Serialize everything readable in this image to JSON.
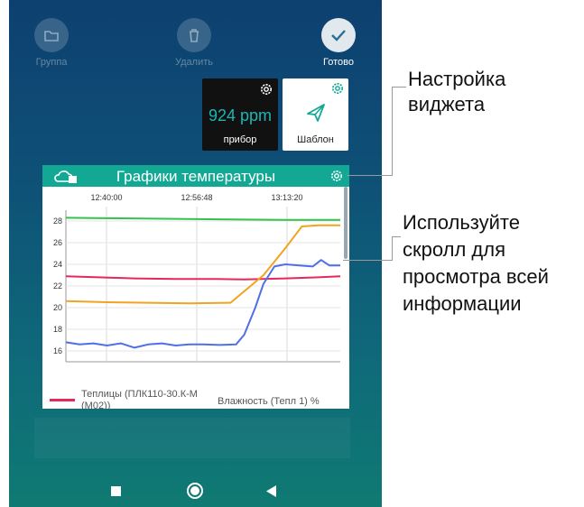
{
  "toolbar": {
    "group_label": "Группа",
    "delete_label": "Удалить",
    "done_label": "Готово"
  },
  "tiles": {
    "device": {
      "value": "924 ppm",
      "label": "прибор"
    },
    "template": {
      "label": "Шаблон"
    }
  },
  "widget": {
    "title": "Графики температуры"
  },
  "chart_data": {
    "type": "line",
    "x_ticks": [
      "12:40:00",
      "12:56:48",
      "13:13:20"
    ],
    "y_ticks": [
      28,
      26,
      24,
      22,
      20,
      18,
      16
    ],
    "ylim": [
      15,
      29
    ],
    "grid": true,
    "series": [
      {
        "color": "#33c24d",
        "points": [
          [
            0,
            28.3
          ],
          [
            0.2,
            28.25
          ],
          [
            0.4,
            28.2
          ],
          [
            0.6,
            28.15
          ],
          [
            0.8,
            28.1
          ],
          [
            1,
            28.1
          ]
        ]
      },
      {
        "color": "#e6285a",
        "points": [
          [
            0,
            22.9
          ],
          [
            0.12,
            22.8
          ],
          [
            0.25,
            22.7
          ],
          [
            0.4,
            22.65
          ],
          [
            0.55,
            22.65
          ],
          [
            0.65,
            22.6
          ],
          [
            0.8,
            22.7
          ],
          [
            0.92,
            22.8
          ],
          [
            1,
            22.9
          ]
        ]
      },
      {
        "color": "#f2a31f",
        "points": [
          [
            0,
            20.6
          ],
          [
            0.15,
            20.5
          ],
          [
            0.3,
            20.45
          ],
          [
            0.45,
            20.4
          ],
          [
            0.6,
            20.45
          ],
          [
            0.72,
            23.0
          ],
          [
            0.8,
            25.5
          ],
          [
            0.86,
            27.5
          ],
          [
            0.92,
            27.6
          ],
          [
            1,
            27.6
          ]
        ]
      },
      {
        "color": "#4f6fe6",
        "points": [
          [
            0,
            16.8
          ],
          [
            0.05,
            16.6
          ],
          [
            0.1,
            16.7
          ],
          [
            0.15,
            16.5
          ],
          [
            0.2,
            16.7
          ],
          [
            0.25,
            16.3
          ],
          [
            0.3,
            16.6
          ],
          [
            0.35,
            16.7
          ],
          [
            0.4,
            16.5
          ],
          [
            0.45,
            16.6
          ],
          [
            0.5,
            16.6
          ],
          [
            0.56,
            16.55
          ],
          [
            0.62,
            16.6
          ],
          [
            0.65,
            17.5
          ],
          [
            0.69,
            20.0
          ],
          [
            0.72,
            22.2
          ],
          [
            0.76,
            23.8
          ],
          [
            0.8,
            24.0
          ],
          [
            0.85,
            23.9
          ],
          [
            0.9,
            23.8
          ],
          [
            0.93,
            24.4
          ],
          [
            0.96,
            23.9
          ],
          [
            1,
            23.9
          ]
        ]
      }
    ]
  },
  "legend": {
    "series_a": "Теплицы (ПЛК110-30.К-М (М02))",
    "series_b": "Влажность (Тепл 1) %"
  },
  "callouts": {
    "settings": [
      "Настройка",
      "виджета"
    ],
    "scroll": [
      "Используйте",
      "скролл для",
      "просмотра всей",
      "информации"
    ]
  }
}
